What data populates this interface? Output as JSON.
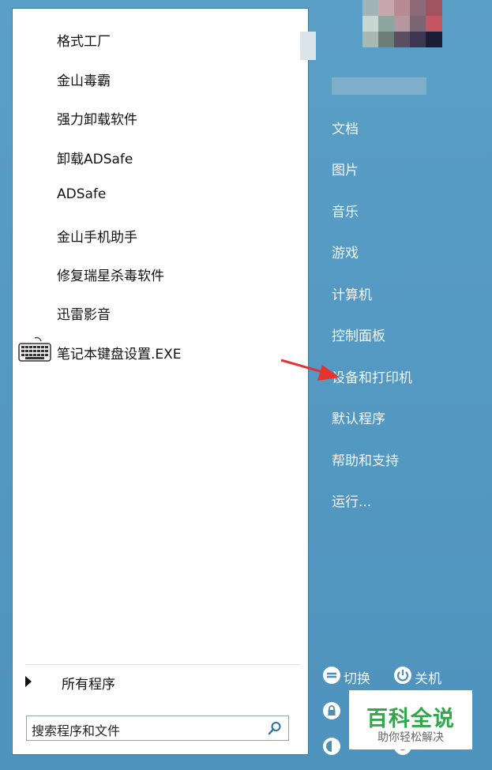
{
  "start_menu": {
    "programs": [
      {
        "label": "格式工厂"
      },
      {
        "label": "金山毒霸"
      },
      {
        "label": "强力卸载软件"
      },
      {
        "label": "卸载ADSafe"
      },
      {
        "label": "ADSafe"
      },
      {
        "label": "金山手机助手"
      },
      {
        "label": "修复瑞星杀毒软件"
      },
      {
        "label": "迅雷影音"
      },
      {
        "label": "笔记本键盘设置.EXE",
        "icon": "keyboard-icon"
      }
    ],
    "all_programs_label": "所有程序",
    "search": {
      "placeholder": "搜索程序和文件"
    },
    "right_items": [
      {
        "label": "文档"
      },
      {
        "label": "图片"
      },
      {
        "label": "音乐"
      },
      {
        "label": "游戏"
      },
      {
        "label": "计算机"
      },
      {
        "label": "控制面板"
      },
      {
        "label": "设备和打印机"
      },
      {
        "label": "默认程序"
      },
      {
        "label": "帮助和支持"
      },
      {
        "label": "运行..."
      }
    ],
    "bottom": {
      "switch_label": "切换",
      "shutdown_label": "关机"
    }
  },
  "watermark": {
    "title": "百科全说",
    "subtitle": "助你轻松解决"
  },
  "colors": {
    "panel_blue": "#5599c0",
    "arrow_red": "#e8322e",
    "watermark_green": "#2fa84a"
  }
}
